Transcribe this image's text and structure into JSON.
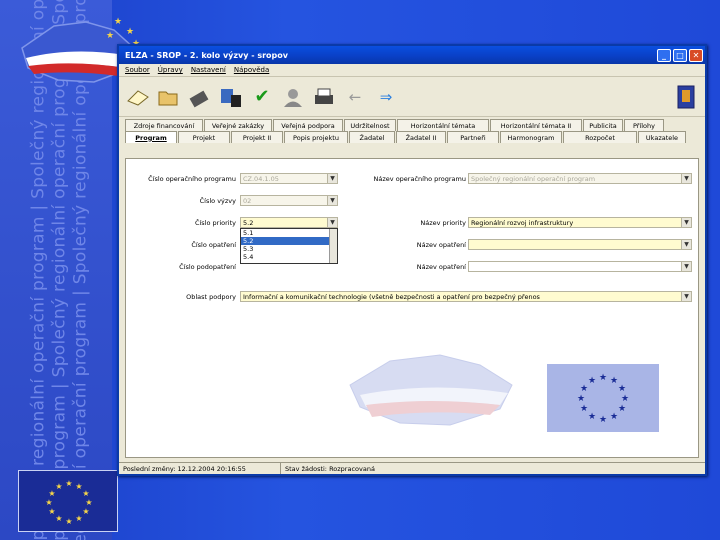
{
  "slide": {
    "side_text": [
      "Společný regionální operační program  |  Společný regionální operační program  |",
      "operační program  |  Společný regionální operační program  |  Společný regionální",
      "regionální operační program  |  Společný regionální operační program  |  Společný"
    ]
  },
  "window": {
    "title": "ELZA - SROP - 2. kolo výzvy - sropov",
    "menu": [
      "Soubor",
      "Úpravy",
      "Nastavení",
      "Nápověda"
    ]
  },
  "toolbar": {
    "icons": [
      "new-document",
      "open-folder",
      "tools",
      "save",
      "check",
      "person",
      "print",
      "arrow-left",
      "arrow-right",
      "exit"
    ]
  },
  "tabs_row1": [
    "Zdroje financování",
    "Veřejné zakázky",
    "Veřejná podpora",
    "Udržitelnost",
    "Horizontální témata",
    "Horizontální témata II",
    "Publicita",
    "Přílohy"
  ],
  "tabs_row2": [
    "Program",
    "Projekt",
    "Projekt II",
    "Popis projektu",
    "Žadatel",
    "Žadatel II",
    "Partneři",
    "Harmonogram",
    "Rozpočet",
    "Ukazatele"
  ],
  "form": {
    "cislo_programu_label": "Číslo operačního programu",
    "cislo_programu_value": "CZ.04.1.05",
    "nazev_programu_label": "Název operačního programu",
    "nazev_programu_value": "Společný regionální operační program",
    "cislo_vyzvy_label": "Číslo výzvy",
    "cislo_vyzvy_value": "02",
    "cislo_priority_label": "Číslo priority",
    "cislo_priority_value": "5.2",
    "nazev_priority_label": "Název priority",
    "nazev_priority_value": "Regionální rozvoj infrastruktury",
    "cislo_opatreni_label": "Číslo opatření",
    "nazev_opatreni_label": "Název opatření",
    "cislo_podopatreni_label": "Číslo podopatření",
    "nazev_podopatreni_label": "Název opatření",
    "oblast_podpory_label": "Oblast podpory",
    "oblast_podpory_value": "Informační a komunikační technologie (všetně bezpečnosti a opatření pro bezpečný přenos",
    "priority_options": [
      "5.1",
      "5.2",
      "5.3",
      "5.4"
    ],
    "priority_selected_index": 1
  },
  "status": {
    "left": "Poslední změny: 12.12.2004 20:16:55",
    "right": "Stav žádosti: Rozpracovaná"
  },
  "colors": {
    "title_bar": "#0a4fe0",
    "slide_bg": "#1d45d2",
    "selection": "#316ac5"
  }
}
